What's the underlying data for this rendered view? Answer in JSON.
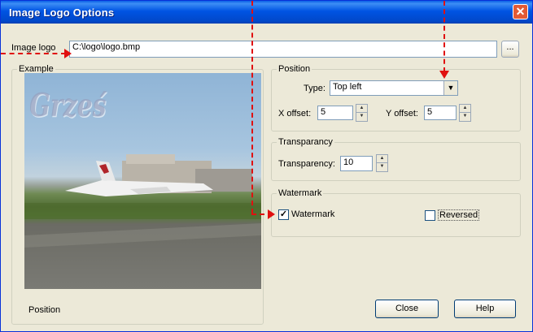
{
  "window": {
    "title": "Image Logo Options"
  },
  "image_logo": {
    "label": "Image logo",
    "value": "C:\\logo\\logo.bmp",
    "browse_label": "..."
  },
  "example": {
    "group_title": "Example",
    "watermark_text": "Grześ",
    "caption": "Position"
  },
  "position": {
    "group_title": "Position",
    "type_label": "Type:",
    "type_value": "Top left",
    "x_offset_label": "X offset:",
    "x_offset_value": "5",
    "y_offset_label": "Y offset:",
    "y_offset_value": "5"
  },
  "transparency": {
    "group_title": "Transparancy",
    "label": "Transparency:",
    "value": "10"
  },
  "watermark": {
    "group_title": "Watermark",
    "watermark_label": "Watermark",
    "watermark_checked": true,
    "reversed_label": "Reversed",
    "reversed_checked": false
  },
  "buttons": {
    "close": "Close",
    "help": "Help"
  },
  "colors": {
    "title_bar": "#0054e3",
    "dialog_bg": "#ece9d8",
    "annotation_arrow": "#e01010"
  }
}
